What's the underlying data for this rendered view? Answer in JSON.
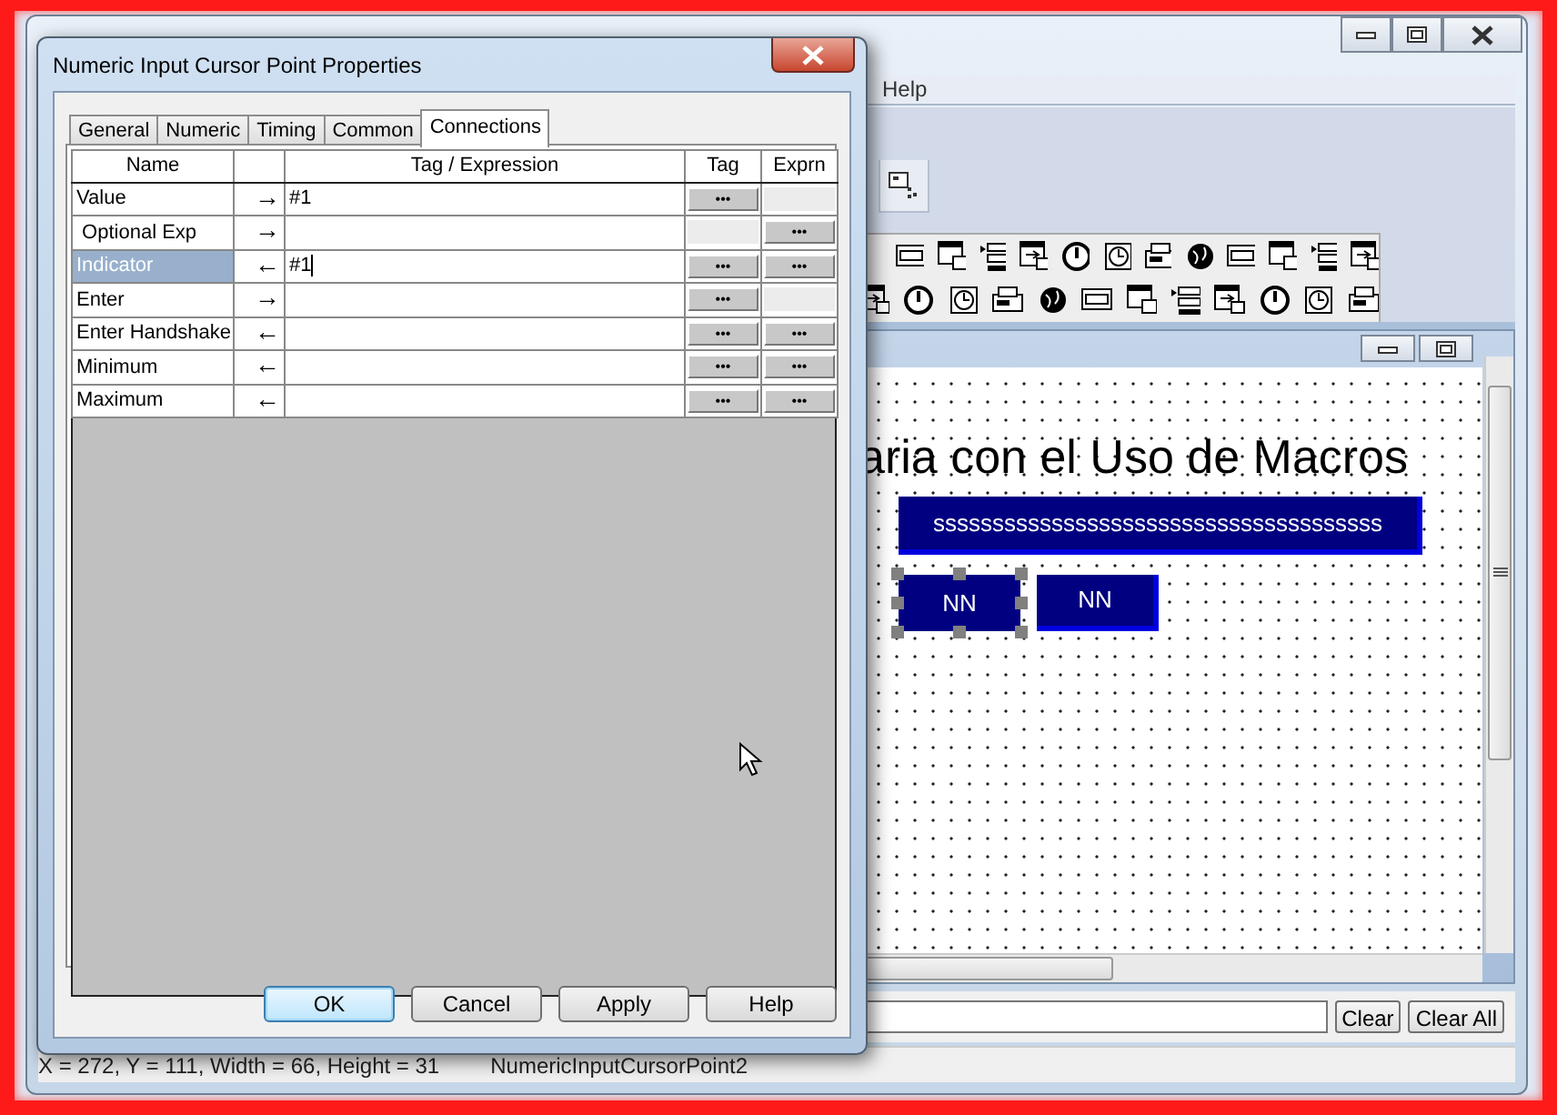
{
  "app": {
    "menu": [
      "Help"
    ],
    "canvas": {
      "heading": "aria con el Uso de Macros",
      "objects": [
        {
          "kind": "wide",
          "text": "ssssssssssssssssssssssssssssssssssssss",
          "selected": false
        },
        {
          "kind": "small",
          "text": "NN",
          "selected": true
        },
        {
          "kind": "small",
          "text": "NN",
          "selected": false
        }
      ]
    },
    "command_bar": {
      "buttons": [
        "Clear",
        "Clear All"
      ]
    },
    "status_bar": [
      "X = 272, Y = 111, Width = 66, Height = 31",
      "NumericInputCursorPoint2"
    ]
  },
  "dialog": {
    "title": "Numeric Input Cursor Point Properties",
    "tabs": [
      {
        "label": "General",
        "selected": false
      },
      {
        "label": "Numeric",
        "selected": false
      },
      {
        "label": "Timing",
        "selected": false
      },
      {
        "label": "Common",
        "selected": false
      },
      {
        "label": "Connections",
        "selected": true
      }
    ],
    "columns": {
      "name": "Name",
      "expression": "Tag / Expression",
      "tag": "Tag",
      "expr": "Exprn"
    },
    "rows": [
      {
        "name": "Value",
        "arrow": "→",
        "value": "#1",
        "tag_button": "•••",
        "expr_button": null,
        "selected": false,
        "editing": false
      },
      {
        "name": " Optional Exp",
        "arrow": "→",
        "value": null,
        "tag_button": null,
        "expr_button": "•••",
        "selected": false,
        "editing": false
      },
      {
        "name": "Indicator",
        "arrow": "←",
        "value": "#1",
        "tag_button": "•••",
        "expr_button": "•••",
        "selected": true,
        "editing": true
      },
      {
        "name": "Enter",
        "arrow": "→",
        "value": null,
        "tag_button": "•••",
        "expr_button": null,
        "selected": false,
        "editing": false
      },
      {
        "name": "Enter Handshake",
        "arrow": "←",
        "value": null,
        "tag_button": "•••",
        "expr_button": "•••",
        "selected": false,
        "editing": false
      },
      {
        "name": "Minimum",
        "arrow": "←",
        "value": null,
        "tag_button": "•••",
        "expr_button": "•••",
        "selected": false,
        "editing": false
      },
      {
        "name": "Maximum",
        "arrow": "←",
        "value": null,
        "tag_button": "•••",
        "expr_button": "•••",
        "selected": false,
        "editing": false
      }
    ],
    "buttons": [
      {
        "label": "OK",
        "default": true
      },
      {
        "label": "Cancel",
        "default": false
      },
      {
        "label": "Apply",
        "default": false
      },
      {
        "label": "Help",
        "default": false
      }
    ]
  }
}
